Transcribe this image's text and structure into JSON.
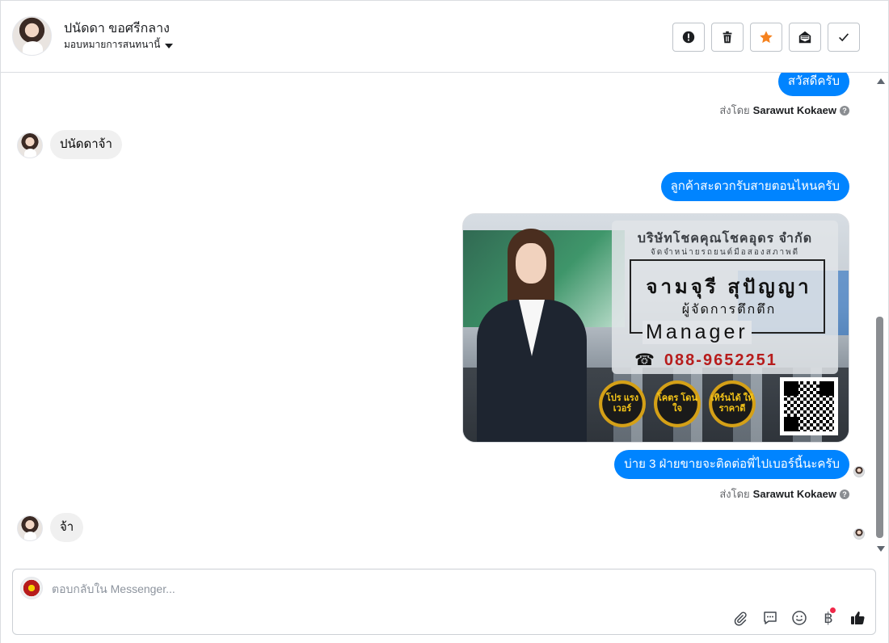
{
  "header": {
    "contact_name": "ปนัดดา ขอศรีกลาง",
    "assign_label": "มอบหมายการสนทนานี้",
    "actions": [
      {
        "icon": "alert-icon",
        "label": "Spam"
      },
      {
        "icon": "trash-icon",
        "label": "Delete"
      },
      {
        "icon": "star-icon",
        "label": "Follow up"
      },
      {
        "icon": "mark-unread-icon",
        "label": "Mark as unread"
      },
      {
        "icon": "check-icon",
        "label": "Mark as done"
      }
    ],
    "star_color": "#f5821f"
  },
  "messages": [
    {
      "direction": "out",
      "text": "สวัสดีครับ"
    },
    {
      "sent_by_prefix": "ส่งโดย",
      "sent_by_name": "Sarawut Kokaew"
    },
    {
      "direction": "in",
      "text": "ปนัดดาจ้า"
    },
    {
      "direction": "out",
      "text": "ลูกค้าสะดวกรับสายตอนไหนครับ"
    },
    {
      "direction": "out",
      "type": "image"
    },
    {
      "direction": "out",
      "text": "บ่าย 3 ฝ่ายขายจะติดต่อพี่ไปเบอร์นี้นะครับ"
    },
    {
      "sent_by_prefix": "ส่งโดย",
      "sent_by_name": "Sarawut Kokaew"
    },
    {
      "direction": "in",
      "text": "จ้า"
    }
  ],
  "card": {
    "company": "บริษัทโชคคุณโชคอุดร จำกัด",
    "company_sub": "จัดจำหน่ายรถยนต์มือสองสภาพดี",
    "person_name": "จามจุรี สุปัญญา",
    "role_th": "ผู้จัดการตึกตึก",
    "role_en": "Manager",
    "phone_glyph": "☎",
    "phone": "088-9652251",
    "badges": [
      "โปร แรง เวอร์",
      "โคตร โดนใจ",
      "เทิร์นได้ ให้ราคาดี"
    ]
  },
  "composer": {
    "placeholder": "ตอบกลับใน Messenger...",
    "tools": [
      "attach-icon",
      "saved-reply-icon",
      "emoji-icon",
      "baht-icon",
      "like-icon"
    ],
    "baht_glyph": "฿"
  },
  "colors": {
    "bubble_out": "#0084ff",
    "bubble_in": "#f0f0f0",
    "notification_dot": "#f02849"
  }
}
